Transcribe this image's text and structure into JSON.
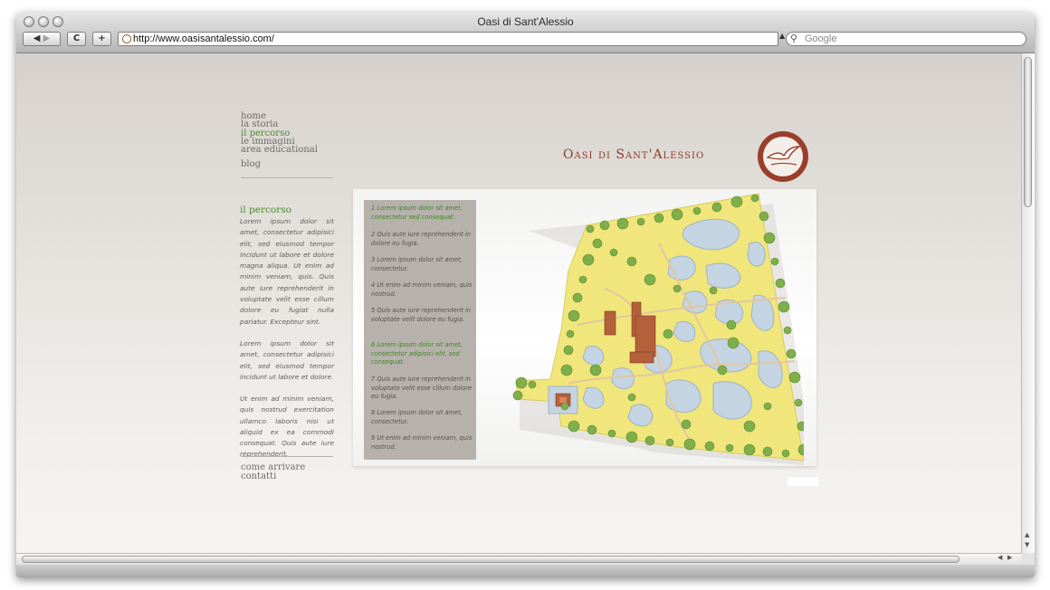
{
  "window": {
    "title": "Oasi di Sant'Alessio"
  },
  "toolbar": {
    "back_glyph": "◀",
    "forward_glyph": "▶",
    "reload_glyph": "C",
    "add_glyph": "+",
    "url": "http://www.oasisantalessio.com/",
    "search_placeholder": "Google"
  },
  "site": {
    "brand": "Oasi di Sant'Alessio",
    "nav": [
      {
        "label": "home",
        "active": false
      },
      {
        "label": "la storia",
        "active": false
      },
      {
        "label": "il percorso",
        "active": true
      },
      {
        "label": "le immagini",
        "active": false
      },
      {
        "label": "area educational",
        "active": false
      },
      {
        "label": "blog",
        "active": false
      }
    ],
    "footer_nav": [
      "come arrivare",
      "contatti"
    ],
    "section_title": "il percorso",
    "paragraphs": [
      "Lorem ipsum dolor sit amet, consectetur adipisici elit, sed eiusmod tempor incidunt ut labore et dolore magna aliqua. Ut enim ad minim veniam, quis. Quis aute iure reprehenderit in voluptate velit esse cillum dolore eu fugiat nulla pariatur. Excepteur sint.",
      "Lorem ipsum dolor sit amet, consectetur adipisici elit, sed eiusmod tempor incidunt ut labore et dolore.",
      "Ut enim ad minim veniam, quis nostrud exercitation ullamco laboris nisi ut aliquid ex ea commodi consequat. Quis aute iure reprehenderit."
    ],
    "steps": [
      {
        "num": "1",
        "text": "Lorem ipsum dolor sit amet, consectetur sed consequat.",
        "active": true
      },
      {
        "num": "2",
        "text": "Quis aute iure reprehenderit in dolore eu fugia.",
        "active": false
      },
      {
        "num": "3",
        "text": "Lorem ipsum dolor sit amet, consectetur.",
        "active": false
      },
      {
        "num": "4",
        "text": "Ut enim ad minim veniam, quis nostrud.",
        "active": false
      },
      {
        "num": "5",
        "text": "Quis aute iure reprehenderit in voluptate velit dolore eu fugia.",
        "active": false
      },
      {
        "num": "6",
        "text": "Lorem ipsum dolor sit amet, consectetur adipisici elit, sed consequat.",
        "active": true
      },
      {
        "num": "7",
        "text": "Quis aute iure reprehenderit in voluptate velit esse cillum dolore eu fugia.",
        "active": false
      },
      {
        "num": "8",
        "text": "Lorem ipsum dolor sit amet, consectetur.",
        "active": false
      },
      {
        "num": "9",
        "text": "Ut enim ad minim veniam, quis nostrud.",
        "active": false
      }
    ]
  },
  "colors": {
    "accent_green": "#4b8b2c",
    "brand_red": "#8f3a2a",
    "map_land": "#f0e67c",
    "map_water": "#c5d4e2",
    "map_building": "#b4603a",
    "map_tree": "#7fae4a"
  }
}
